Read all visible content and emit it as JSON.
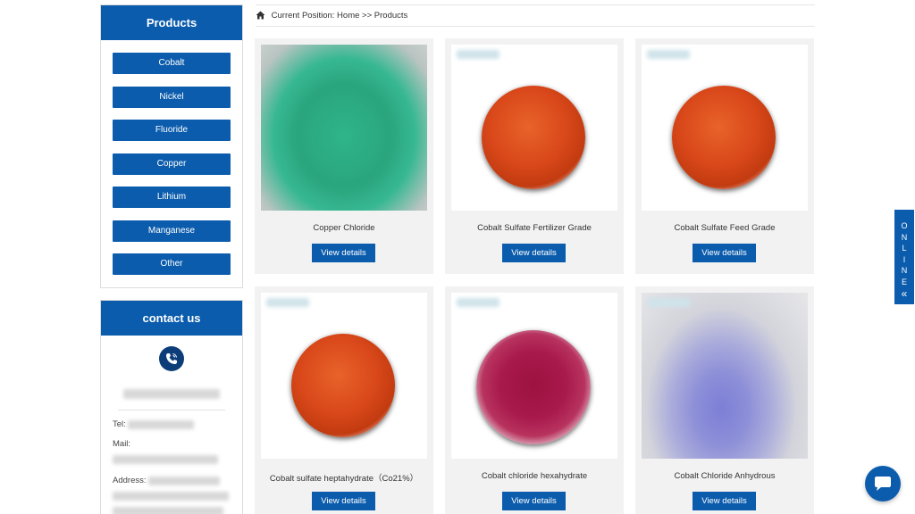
{
  "sidebar": {
    "products_title": "Products",
    "categories": [
      "Cobalt",
      "Nickel",
      "Fluoride",
      "Copper",
      "Lithium",
      "Manganese",
      "Other"
    ],
    "contact_title": "contact us",
    "tel_label": "Tel:",
    "mail_label": "Mail:",
    "address_label": "Address:"
  },
  "breadcrumb": {
    "prefix": "Current Position:",
    "home": "Home",
    "separator": ">>",
    "current": "Products"
  },
  "products": [
    {
      "name": "Copper Chloride",
      "button": "View details"
    },
    {
      "name": "Cobalt Sulfate Fertilizer Grade",
      "button": "View details"
    },
    {
      "name": "Cobalt Sulfate Feed Grade",
      "button": "View details"
    },
    {
      "name": "Cobalt sulfate heptahydrate（Co21%）",
      "button": "View details"
    },
    {
      "name": "Cobalt chloride hexahydrate",
      "button": "View details"
    },
    {
      "name": "Cobalt Chloride Anhydrous",
      "button": "View details"
    }
  ],
  "online_tab": {
    "letters": [
      "O",
      "N",
      "L",
      "I",
      "N",
      "E"
    ],
    "icon": "double-chevron-left-icon"
  },
  "colors": {
    "primary": "#0b5cad",
    "card_bg": "#f2f2f2",
    "phone_circle": "#0d3d78"
  }
}
